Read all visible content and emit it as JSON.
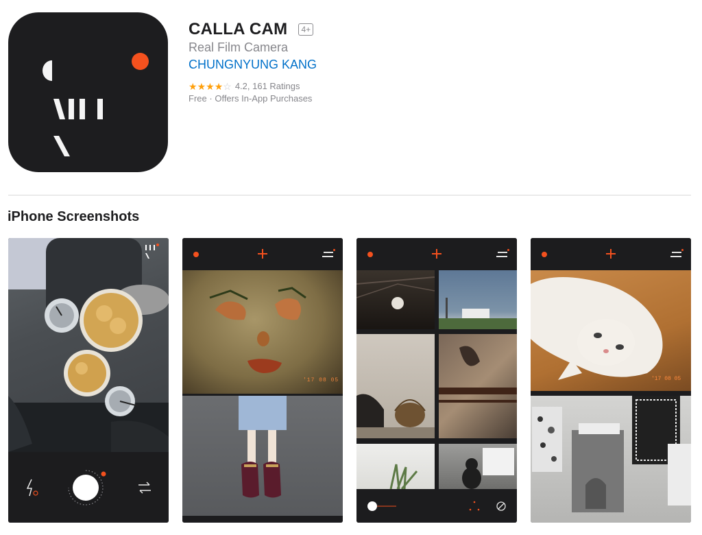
{
  "app": {
    "name": "CALLA CAM",
    "age_rating": "4+",
    "subtitle": "Real Film Camera",
    "developer": "CHUNGNYUNG KANG",
    "rating_value": 4.2,
    "rating_text": "4.2, 161 Ratings",
    "price": "Free",
    "price_separator": "·",
    "in_app": "Offers In-App Purchases"
  },
  "sections": {
    "screenshots_title": "iPhone Screenshots"
  },
  "screenshots": [
    {
      "datestamp": ""
    },
    {
      "datestamp": "'17 08 05"
    },
    {
      "datestamp": ""
    },
    {
      "datestamp": "'17 08 05"
    }
  ],
  "icons": [
    "app-logo-icon",
    "star-icon",
    "flash-icon",
    "shutter-icon",
    "switch-camera-icon",
    "plus-icon",
    "menu-icon",
    "cancel-icon",
    "filter-dots-icon"
  ],
  "colors": {
    "accent": "#f4511e",
    "link": "#0070c9",
    "star": "#ff9f0a",
    "app_icon_bg": "#1d1d1f",
    "secondary_text": "#86868b"
  }
}
